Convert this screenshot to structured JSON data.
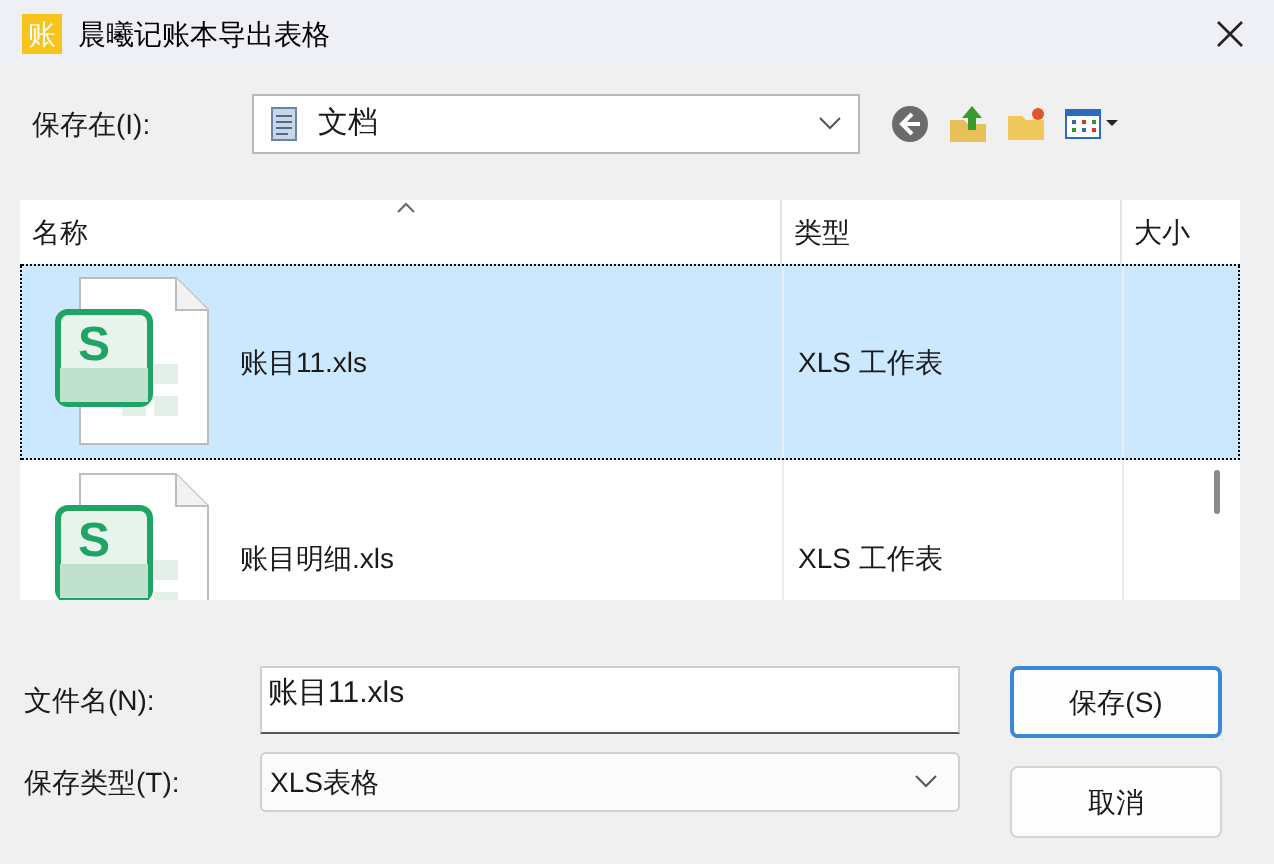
{
  "window": {
    "title": "晨曦记账本导出表格",
    "icon_text": "账"
  },
  "save_in": {
    "label": "保存在(I):",
    "value": "文档"
  },
  "columns": [
    {
      "label": "名称",
      "sorted": true
    },
    {
      "label": "类型",
      "sorted": false
    },
    {
      "label": "大小",
      "sorted": false
    }
  ],
  "rows": [
    {
      "name": "账目11.xls",
      "type": "XLS 工作表",
      "icon_text": "S",
      "selected": true
    },
    {
      "name": "账目明细.xls",
      "type": "XLS 工作表",
      "icon_text": "S",
      "selected": false
    }
  ],
  "file_name": {
    "label": "文件名(N):",
    "value": "账目11.xls"
  },
  "file_type": {
    "label": "保存类型(T):",
    "value": "XLS表格"
  },
  "buttons": [
    {
      "label": "保存(S)",
      "kind": "default"
    },
    {
      "label": "取消",
      "kind": "normal"
    }
  ]
}
